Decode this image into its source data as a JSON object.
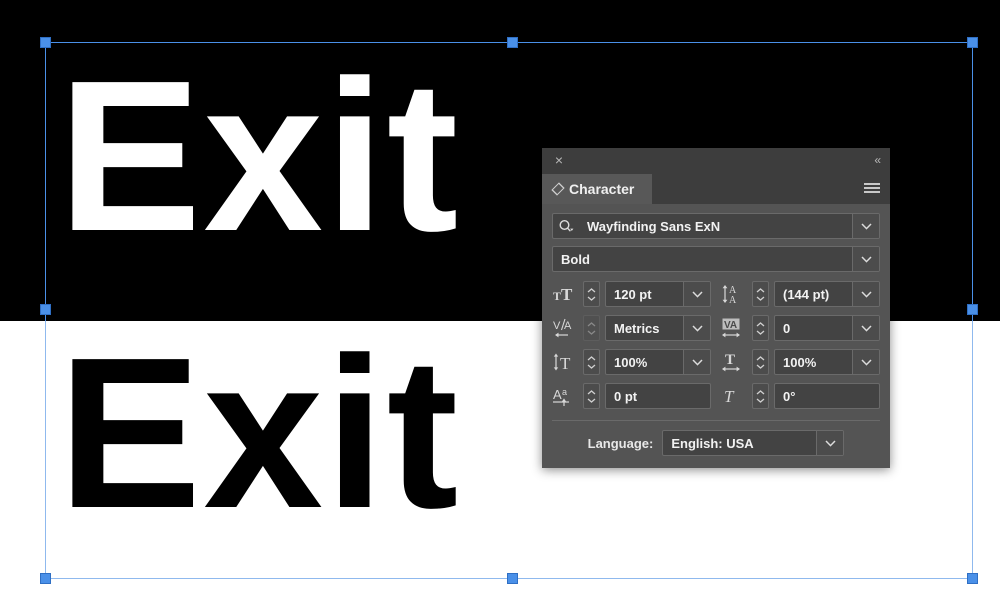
{
  "canvas": {
    "top_band_color": "#000000",
    "bottom_band_color": "#ffffff",
    "top_text": "Exit",
    "bottom_text": "Exit",
    "selection_color": "#4a90e8"
  },
  "panel": {
    "close_label": "×",
    "collapse_label": "«",
    "tab_label": "Character",
    "accent_color": "#4a90e8",
    "font_family": {
      "value": "Wayfinding Sans ExN",
      "icon": "search-icon"
    },
    "font_style": {
      "value": "Bold"
    },
    "metrics": [
      {
        "name": "font-size",
        "icon": "font-size-icon",
        "value": "120 pt",
        "has_dropdown": true,
        "stepper_enabled": true
      },
      {
        "name": "leading",
        "icon": "leading-icon",
        "value": "(144 pt)",
        "has_dropdown": true,
        "stepper_enabled": true
      },
      {
        "name": "kerning",
        "icon": "kerning-icon",
        "value": "Metrics",
        "has_dropdown": true,
        "stepper_enabled": false
      },
      {
        "name": "tracking",
        "icon": "tracking-icon",
        "value": "0",
        "has_dropdown": true,
        "stepper_enabled": true
      },
      {
        "name": "vertical-scale",
        "icon": "vertical-scale-icon",
        "value": "100%",
        "has_dropdown": true,
        "stepper_enabled": true
      },
      {
        "name": "horizontal-scale",
        "icon": "horizontal-scale-icon",
        "value": "100%",
        "has_dropdown": true,
        "stepper_enabled": true
      },
      {
        "name": "baseline-shift",
        "icon": "baseline-shift-icon",
        "value": "0 pt",
        "has_dropdown": false,
        "stepper_enabled": true
      },
      {
        "name": "skew",
        "icon": "skew-icon",
        "value": "0°",
        "has_dropdown": false,
        "stepper_enabled": true
      }
    ],
    "language": {
      "label": "Language:",
      "value": "English: USA"
    }
  }
}
